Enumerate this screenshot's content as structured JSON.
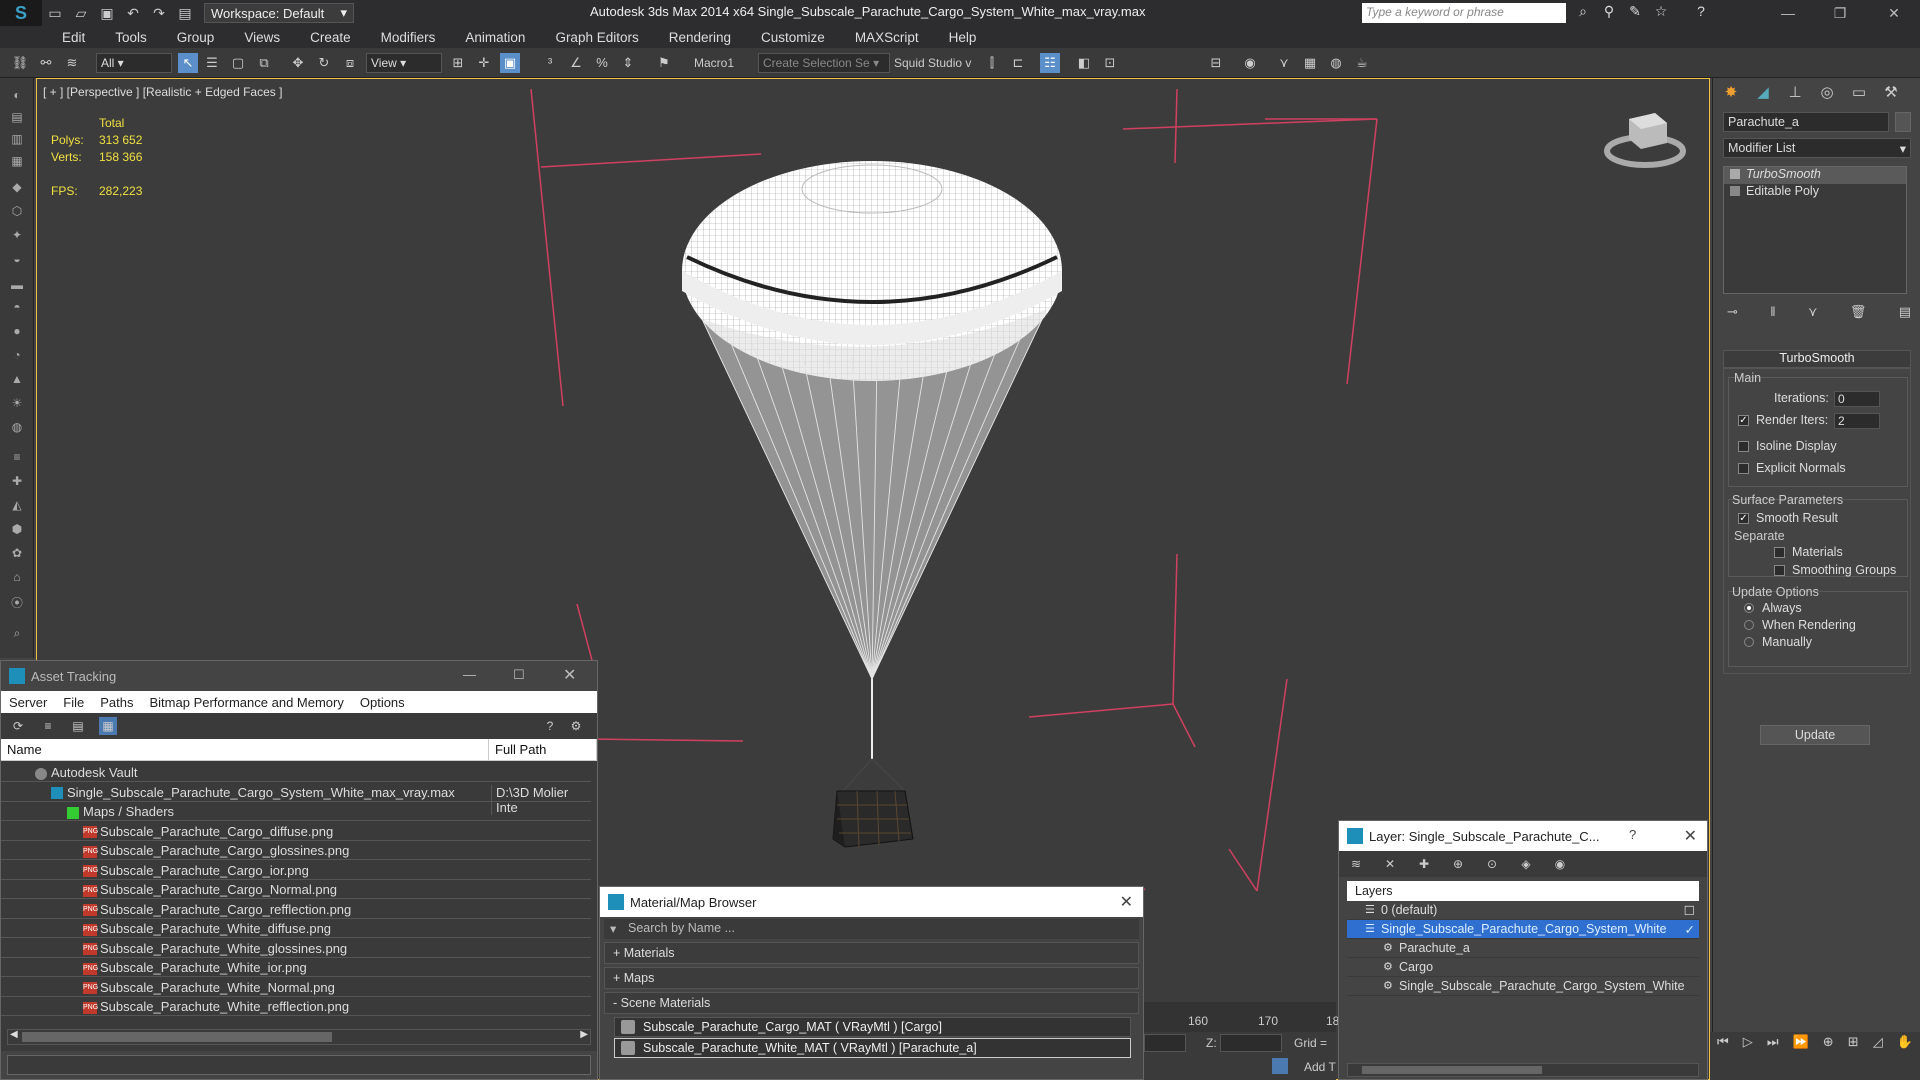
{
  "app": {
    "title": "Autodesk 3ds Max  2014 x64     Single_Subscale_Parachute_Cargo_System_White_max_vray.max",
    "workspace": "Workspace: Default",
    "search_placeholder": "Type a keyword or phrase"
  },
  "menu": [
    "Edit",
    "Tools",
    "Group",
    "Views",
    "Create",
    "Modifiers",
    "Animation",
    "Graph Editors",
    "Rendering",
    "Customize",
    "MAXScript",
    "Help"
  ],
  "toolbar": {
    "filter": "All",
    "view": "View",
    "macro": "Macro1",
    "selection_set": "Create Selection Se",
    "squid": "Squid Studio v"
  },
  "viewport": {
    "label": "[ + ] [Perspective ] [Realistic + Edged Faces ]",
    "stats": {
      "total_label": "Total",
      "polys_label": "Polys:",
      "polys": "313 652",
      "verts_label": "Verts:",
      "verts": "158 366",
      "fps_label": "FPS:",
      "fps": "282,223"
    }
  },
  "command_panel": {
    "object_name": "Parachute_a",
    "modifier_list": "Modifier List",
    "stack": [
      "TurboSmooth",
      "Editable Poly"
    ],
    "turbosmooth": {
      "title": "TurboSmooth",
      "main_label": "Main",
      "iterations_label": "Iterations:",
      "iterations": "0",
      "render_iters_label": "Render Iters:",
      "render_iters": "2",
      "render_iters_checked": true,
      "isoline_label": "Isoline Display",
      "explicit_normals_label": "Explicit Normals",
      "surface_params_label": "Surface Parameters",
      "smooth_result_label": "Smooth Result",
      "smooth_result_checked": true,
      "separate_label": "Separate",
      "materials_label": "Materials",
      "smoothing_groups_label": "Smoothing Groups",
      "update_options_label": "Update Options",
      "always_label": "Always",
      "when_rendering_label": "When Rendering",
      "manually_label": "Manually",
      "update_button": "Update"
    }
  },
  "asset_tracking": {
    "title": "Asset Tracking",
    "menu": [
      "Server",
      "File",
      "Paths",
      "Bitmap Performance and Memory",
      "Options"
    ],
    "columns": [
      "Name",
      "Full Path"
    ],
    "rows": [
      {
        "name": "Autodesk Vault",
        "path": "",
        "indent": 1,
        "icon": "vault"
      },
      {
        "name": "Single_Subscale_Parachute_Cargo_System_White_max_vray.max",
        "path": "D:\\3D Molier Inte",
        "indent": 2,
        "icon": "max"
      },
      {
        "name": "Maps / Shaders",
        "path": "",
        "indent": 3,
        "icon": "maps"
      },
      {
        "name": "Subscale_Parachute_Cargo_diffuse.png",
        "path": "",
        "indent": 4,
        "icon": "png"
      },
      {
        "name": "Subscale_Parachute_Cargo_glossines.png",
        "path": "",
        "indent": 4,
        "icon": "png"
      },
      {
        "name": "Subscale_Parachute_Cargo_ior.png",
        "path": "",
        "indent": 4,
        "icon": "png"
      },
      {
        "name": "Subscale_Parachute_Cargo_Normal.png",
        "path": "",
        "indent": 4,
        "icon": "png"
      },
      {
        "name": "Subscale_Parachute_Cargo_refflection.png",
        "path": "",
        "indent": 4,
        "icon": "png"
      },
      {
        "name": "Subscale_Parachute_White_diffuse.png",
        "path": "",
        "indent": 4,
        "icon": "png"
      },
      {
        "name": "Subscale_Parachute_White_glossines.png",
        "path": "",
        "indent": 4,
        "icon": "png"
      },
      {
        "name": "Subscale_Parachute_White_ior.png",
        "path": "",
        "indent": 4,
        "icon": "png"
      },
      {
        "name": "Subscale_Parachute_White_Normal.png",
        "path": "",
        "indent": 4,
        "icon": "png"
      },
      {
        "name": "Subscale_Parachute_White_refflection.png",
        "path": "",
        "indent": 4,
        "icon": "png"
      }
    ]
  },
  "material_browser": {
    "title": "Material/Map Browser",
    "search_placeholder": "Search by Name ...",
    "sections": [
      "+ Materials",
      "+ Maps",
      "- Scene Materials"
    ],
    "items": [
      "Subscale_Parachute_Cargo_MAT  ( VRayMtl )  [Cargo]",
      "Subscale_Parachute_White_MAT  ( VRayMtl )  [Parachute_a]"
    ]
  },
  "layer_explorer": {
    "title": "Layer: Single_Subscale_Parachute_C...",
    "help": "?",
    "header": "Layers",
    "rows": [
      {
        "name": "0 (default)",
        "indent": 1,
        "selected": false
      },
      {
        "name": "Single_Subscale_Parachute_Cargo_System_White",
        "indent": 1,
        "selected": true
      },
      {
        "name": "Parachute_a",
        "indent": 2,
        "selected": false
      },
      {
        "name": "Cargo",
        "indent": 2,
        "selected": false
      },
      {
        "name": "Single_Subscale_Parachute_Cargo_System_White",
        "indent": 2,
        "selected": false
      }
    ]
  },
  "timeline": {
    "ticks": [
      "160",
      "170",
      "18"
    ],
    "z_label": "Z:",
    "grid_label": "Grid =",
    "add_label": "Add T"
  },
  "colors": {
    "accent": "#f0c040",
    "selection": "#2f6fd0",
    "stats": "#f0e040",
    "grid_red": "#d04060"
  }
}
